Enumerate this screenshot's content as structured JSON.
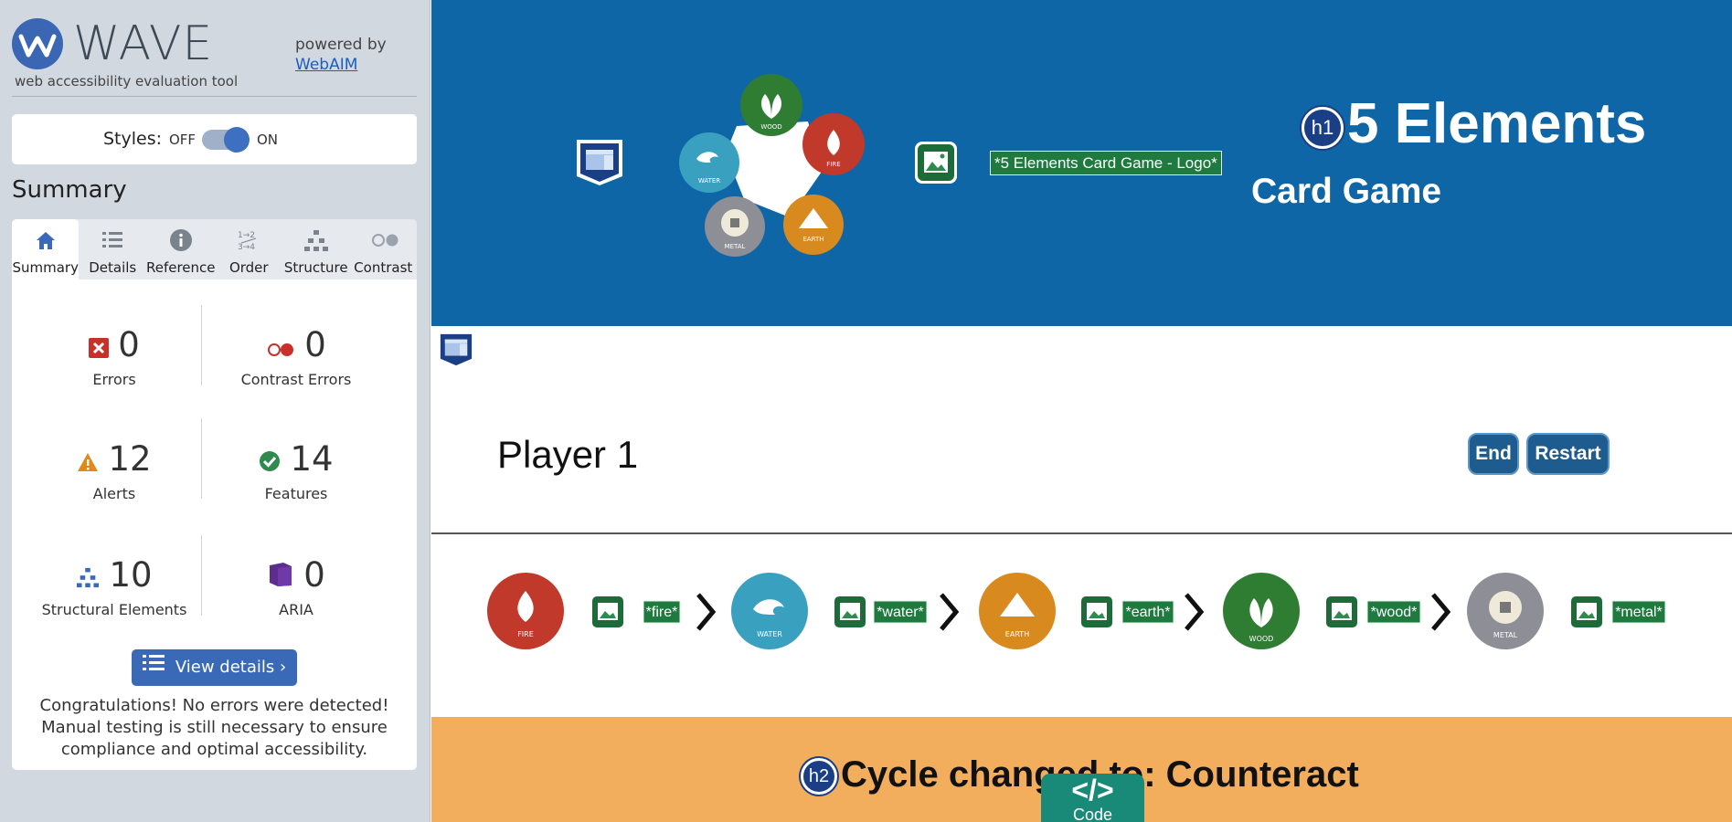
{
  "wave": {
    "brand": "WAVE",
    "tagline": "web accessibility evaluation tool",
    "powered_by": "powered by",
    "webaim_link": "WebAIM",
    "styles_label": "Styles:",
    "styles_off": "OFF",
    "styles_on": "ON",
    "styles_state": "ON",
    "summary_title": "Summary",
    "tabs": [
      {
        "label": "Summary",
        "icon": "home-icon",
        "active": true
      },
      {
        "label": "Details",
        "icon": "list-icon",
        "active": false
      },
      {
        "label": "Reference",
        "icon": "info-icon",
        "active": false
      },
      {
        "label": "Order",
        "icon": "order-icon",
        "active": false
      },
      {
        "label": "Structure",
        "icon": "structure-icon",
        "active": false
      },
      {
        "label": "Contrast",
        "icon": "contrast-icon",
        "active": false
      }
    ],
    "stats": {
      "errors": {
        "value": "0",
        "label": "Errors"
      },
      "contrast_errors": {
        "value": "0",
        "label": "Contrast Errors"
      },
      "alerts": {
        "value": "12",
        "label": "Alerts"
      },
      "features": {
        "value": "14",
        "label": "Features"
      },
      "structural": {
        "value": "10",
        "label": "Structural Elements"
      },
      "aria": {
        "value": "0",
        "label": "ARIA"
      }
    },
    "view_details": "View details ›",
    "congrats": "Congratulations! No errors were detected! Manual testing is still necessary to ensure compliance and optimal accessibility."
  },
  "page": {
    "logo_alt": "*5 Elements Card Game - Logo*",
    "heading_level1": "h1",
    "title": "5 Elements",
    "subtitle": "Card Game",
    "logo_wheel_labels": [
      "WOOD",
      "FIRE",
      "EARTH",
      "METAL",
      "WATER"
    ],
    "player": "Player 1",
    "end_button": "End",
    "restart_button": "Restart",
    "cycle": [
      {
        "name": "FIRE",
        "alt": "*fire*",
        "color": "#c0392b"
      },
      {
        "name": "WATER",
        "alt": "*water*",
        "color": "#3aa0bf"
      },
      {
        "name": "EARTH",
        "alt": "*earth*",
        "color": "#d98a1e"
      },
      {
        "name": "WOOD",
        "alt": "*wood*",
        "color": "#2e7d32"
      },
      {
        "name": "METAL",
        "alt": "*metal*",
        "color": "#8e8e96"
      }
    ],
    "heading_level2": "h2",
    "cycle_heading": "Cycle changed to: Counteract",
    "code_tab_symbol": "</>",
    "code_tab_label": "Code"
  },
  "colors": {
    "header_blue": "#0f66a6",
    "band_orange": "#f3ae5d",
    "wave_blue": "#3a66b3",
    "alt_green": "#1e7a3f",
    "code_teal": "#1a8a78"
  }
}
